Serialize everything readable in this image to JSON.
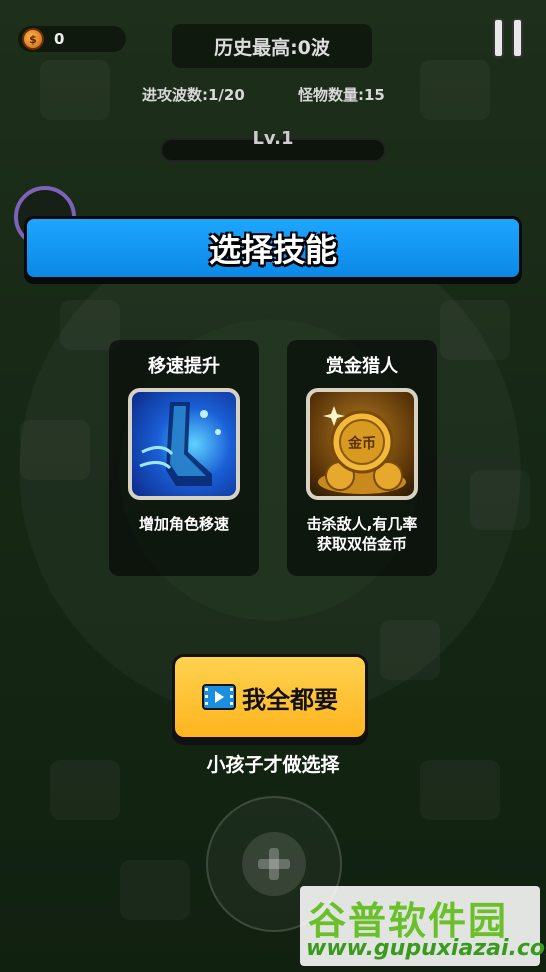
{
  "hud": {
    "coins": "0",
    "best_record": "历史最高:0波",
    "wave": "进攻波数:1/20",
    "monsters": "怪物数量:15",
    "level": "Lv.1"
  },
  "dialog": {
    "title": "选择技能",
    "skills": [
      {
        "name": "移速提升",
        "icon": "speed-boot-icon",
        "desc": "增加角色移速"
      },
      {
        "name": "赏金猎人",
        "icon": "gold-coin-icon",
        "desc": "击杀敌人,有几率获取双倍金币"
      }
    ],
    "take_all_label": "我全都要",
    "skip_text": "小孩子才做选择"
  },
  "watermark": {
    "main": "谷普软件园",
    "url": "www.gupuxiazai.com"
  },
  "colors": {
    "banner": "#1ea6ff",
    "button": "#ffc233",
    "watermark_green": "#6abf2a"
  }
}
